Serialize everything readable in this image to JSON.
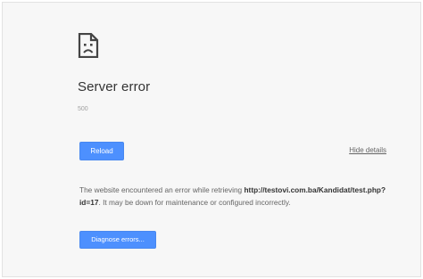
{
  "error_page": {
    "icon": "sad-page-icon",
    "title": "Server error",
    "error_code": "500",
    "reload_label": "Reload",
    "hide_details_label": "Hide details",
    "details": {
      "text_before": "The website encountered an error while retrieving ",
      "url": "http://testovi.com.ba/Kandidat/test.php?id=17",
      "text_after": ". It may be down for maintenance or configured incorrectly."
    },
    "diagnose_label": "Diagnose errors..."
  },
  "colors": {
    "background": "#f7f7f7",
    "button": "#4d90fe",
    "title": "#333333",
    "text": "#646464"
  }
}
